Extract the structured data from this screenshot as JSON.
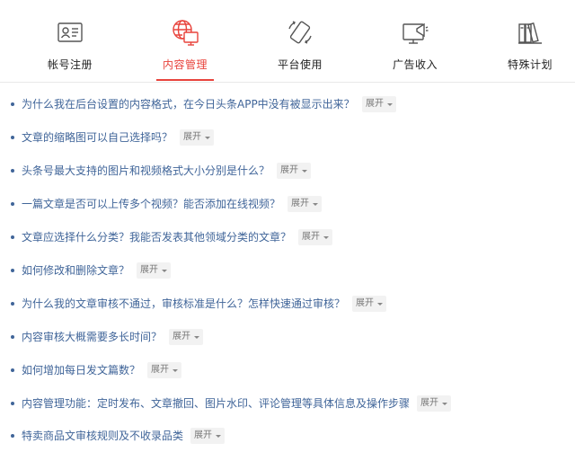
{
  "tabs": [
    {
      "label": "帐号注册",
      "icon": "id-card-icon"
    },
    {
      "label": "内容管理",
      "icon": "content-management-icon",
      "active": true
    },
    {
      "label": "平台使用",
      "icon": "platform-usage-icon"
    },
    {
      "label": "广告收入",
      "icon": "ad-income-icon"
    },
    {
      "label": "特殊计划",
      "icon": "special-plan-icon"
    }
  ],
  "accent_color": "#e8433c",
  "link_color": "#406599",
  "expand_label": "展开",
  "faq": [
    "为什么我在后台设置的内容格式，在今日头条APP中没有被显示出来？",
    "文章的缩略图可以自己选择吗？",
    "头条号最大支持的图片和视频格式大小分别是什么？",
    "一篇文章是否可以上传多个视频？能否添加在线视频？",
    "文章应选择什么分类？我能否发表其他领域分类的文章？",
    "如何修改和删除文章？",
    "为什么我的文章审核不通过，审核标准是什么？怎样快速通过审核？",
    "内容审核大概需要多长时间？",
    "如何增加每日发文篇数？",
    "内容管理功能：定时发布、文章撤回、图片水印、评论管理等具体信息及操作步骤",
    "特卖商品文审核规则及不收录品类"
  ]
}
